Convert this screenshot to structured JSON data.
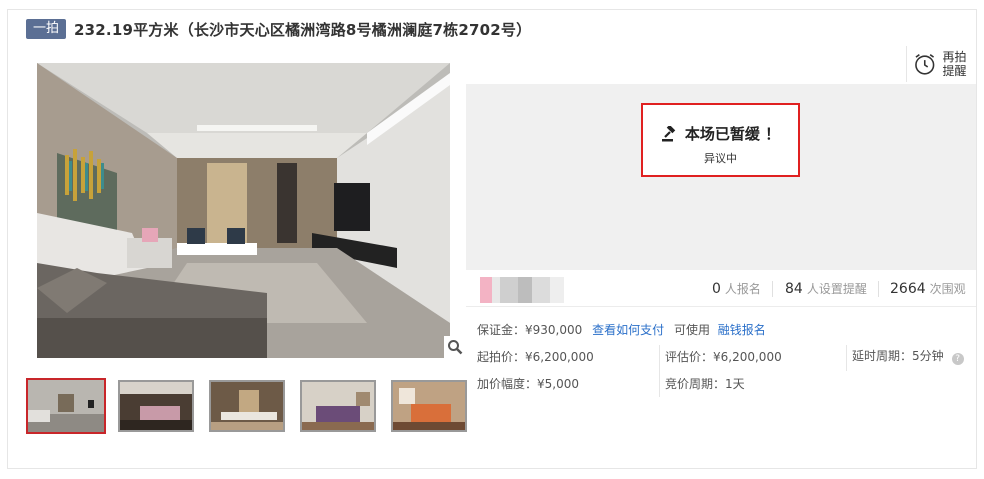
{
  "header": {
    "tag": "一拍",
    "title": "232.19平方米（长沙市天心区橘洲湾路8号橘洲澜庭7栋2702号）"
  },
  "remind_button": {
    "label": "再拍提醒",
    "icon": "alarm-clock-icon"
  },
  "status": {
    "main": "本场已暂缓 ！",
    "sub": "异议中",
    "icon": "gavel-icon",
    "border_color": "#e02020"
  },
  "stats": {
    "signups": {
      "value": "0",
      "unit": "人报名"
    },
    "reminders": {
      "value": "84",
      "unit": "人设置提醒"
    },
    "views": {
      "value": "2664",
      "unit": "次围观"
    }
  },
  "info": {
    "deposit": "保证金：¥930,000",
    "how_to_pay": "查看如何支付",
    "can_use": "可使用",
    "offline_signup": "融钱报名",
    "start_price": "起拍价：¥6,200,000",
    "appraisal": "评估价：¥6,200,000",
    "delay_period": "延时周期：5分钟",
    "increment": "加价幅度：¥5,000",
    "bid_period": "竞价周期：1天"
  },
  "gallery": {
    "thumbnails": [
      "living-room",
      "bedroom-1",
      "dining-room",
      "bedroom-2",
      "master-bedroom"
    ],
    "active_index": 0,
    "zoom_icon": "magnifier-icon"
  },
  "colors": {
    "tag_bg": "#5b6f94",
    "link": "#2a6fc9",
    "active_thumb_border": "#c8262a"
  }
}
